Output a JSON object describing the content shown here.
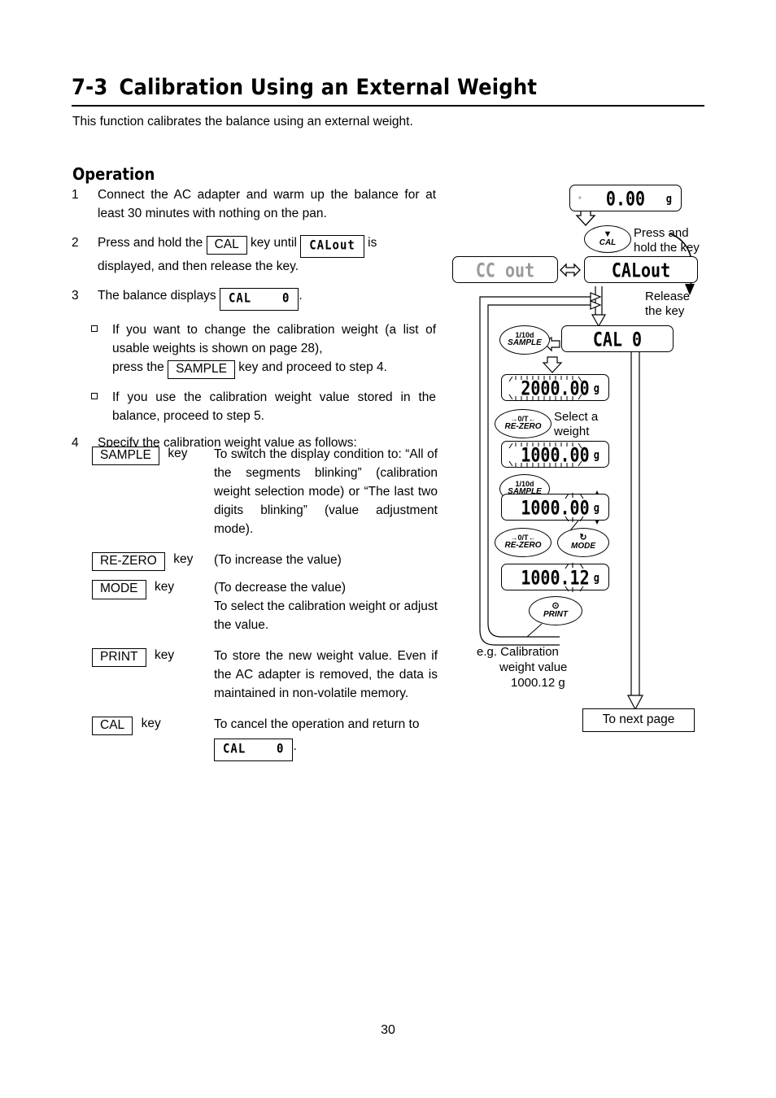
{
  "page": {
    "number": "30",
    "heading_number": "7-3",
    "heading_title": "Calibration Using an External Weight",
    "intro": "This function calibrates the balance using an external weight.",
    "section_title": "Operation"
  },
  "steps": [
    {
      "num": "1",
      "text": "Connect the AC adapter and warm up the balance for at least 30 minutes with nothing on the pan."
    },
    {
      "num": "2",
      "text_a": "Press and hold the",
      "key": "CAL",
      "text_b": "key until",
      "lcd": "CALout",
      "text_c": "is",
      "text_d": "displayed, and then release the key."
    },
    {
      "num": "3",
      "text_a": "The balance displays",
      "lcd": "CAL    0",
      "text_b": "."
    },
    {
      "num": "4",
      "text": "Specify the calibration weight value as follows:"
    }
  ],
  "bullets": [
    {
      "text_a": "If you want to change the calibration weight (a list of usable weights is shown on page 28),",
      "text_b": "press the",
      "key": "SAMPLE",
      "text_c": "key and proceed to step 4."
    },
    {
      "text_a": "If you use the calibration weight value stored in the balance, proceed to step 5."
    }
  ],
  "key_table": [
    {
      "key": "SAMPLE",
      "key_suffix": "key",
      "desc": "To switch the display condition to: “All of the segments blinking” (calibration weight selection mode) or “The last two digits blinking” (value adjustment mode)."
    },
    {
      "key": "RE-ZERO",
      "key_suffix": "key",
      "desc": "(To increase the value)"
    },
    {
      "key": "MODE",
      "key_suffix": "key",
      "desc": "(To decrease the value)",
      "desc2": "To select the calibration weight or adjust the value."
    },
    {
      "key": "PRINT",
      "key_suffix": "key",
      "desc": "To store the new weight value. Even if the AC adapter is removed, the data is maintained in non-volatile memory."
    },
    {
      "key": "CAL",
      "key_suffix": "key",
      "desc": "To cancel the operation and return to",
      "desc_lcd": "CAL    0",
      "desc_tail": "."
    }
  ],
  "diagram": {
    "displays": [
      {
        "id": "d0",
        "value": "0.00",
        "unit": "g",
        "stability": "○",
        "blink": "none"
      },
      {
        "id": "d1",
        "value": "CC out",
        "unit": "",
        "dim": true,
        "blink": "none"
      },
      {
        "id": "d2",
        "value": "CALout",
        "unit": "",
        "blink": "none"
      },
      {
        "id": "d3",
        "value": "CAL    0",
        "unit": "",
        "blink": "none"
      },
      {
        "id": "d4",
        "value": "2000.00",
        "unit": "g",
        "blink": "all"
      },
      {
        "id": "d5",
        "value": "1000.00",
        "unit": "g",
        "blink": "all"
      },
      {
        "id": "d6",
        "value": "1000.00",
        "unit": "g",
        "blink": "last2"
      },
      {
        "id": "d7",
        "value": "1000.12",
        "unit": "g",
        "blink": "last2"
      }
    ],
    "keys": [
      {
        "id": "k_cal",
        "glyph": "▼",
        "name": "CAL",
        "top": ""
      },
      {
        "id": "k_sample1",
        "glyph": "",
        "name": "SAMPLE",
        "top": "1/10d"
      },
      {
        "id": "k_rezero1",
        "glyph": "",
        "name": "RE-ZERO",
        "top": "→0/T←"
      },
      {
        "id": "k_sample2",
        "glyph": "",
        "name": "SAMPLE",
        "top": "1/10d"
      },
      {
        "id": "k_rezero2",
        "glyph": "",
        "name": "RE-ZERO",
        "top": "→0/T←"
      },
      {
        "id": "k_mode",
        "glyph": "↻",
        "name": "MODE",
        "top": ""
      },
      {
        "id": "k_print",
        "glyph": "⊙",
        "name": "PRINT",
        "top": ""
      }
    ],
    "notes": {
      "press_hold": "Press and\nhold the key",
      "release": "Release\nthe key",
      "select_weight": "Select a\nweight"
    },
    "caption": "e.g. Calibration\nweight value\n1000.12 g",
    "caption_line1": "e.g. Calibration",
    "caption_line2": "weight value",
    "caption_line3": "1000.12 g",
    "next_page": "To next page"
  }
}
